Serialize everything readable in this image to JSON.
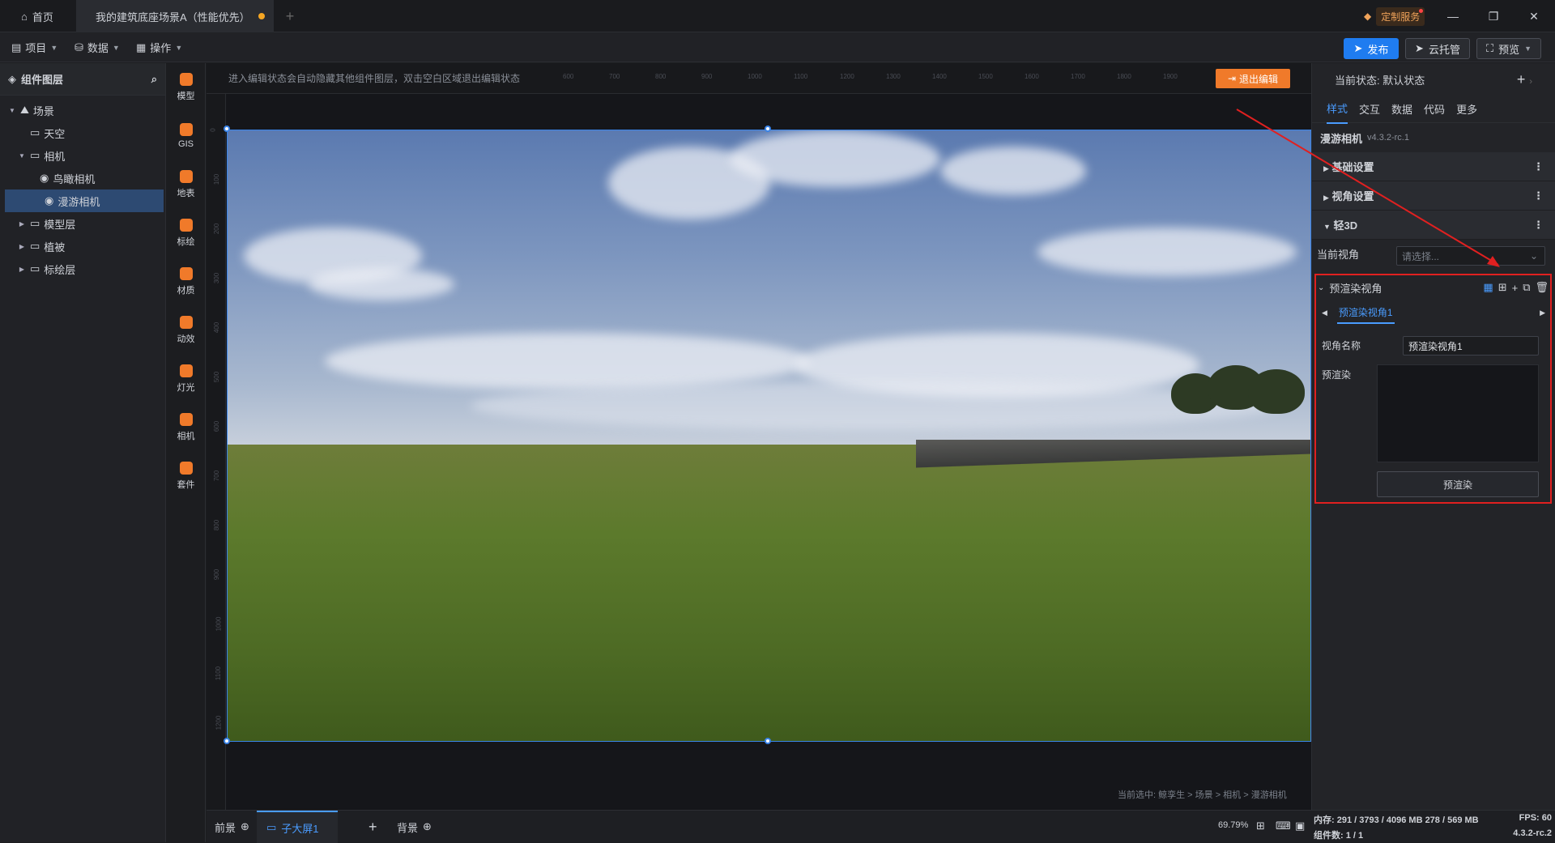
{
  "titlebar": {
    "home_tab": "首页",
    "project_tab": "我的建筑底座场景A（性能优先）",
    "custom_service": "定制服务"
  },
  "menubar": {
    "project": "项目",
    "data": "数据",
    "operate": "操作",
    "publish": "发布",
    "cloud": "云托管",
    "preview": "预览"
  },
  "layers": {
    "title": "组件图层",
    "items": [
      {
        "label": "场景",
        "level": 0,
        "arrow": "▼"
      },
      {
        "label": "天空",
        "level": 1,
        "arrow": ""
      },
      {
        "label": "相机",
        "level": 1,
        "arrow": "▼"
      },
      {
        "label": "鸟瞰相机",
        "level": 2,
        "arrow": ""
      },
      {
        "label": "漫游相机",
        "level": 2,
        "arrow": "",
        "selected": true
      },
      {
        "label": "模型层",
        "level": 1,
        "arrow": "▶"
      },
      {
        "label": "植被",
        "level": 1,
        "arrow": "▶"
      },
      {
        "label": "标绘层",
        "level": 1,
        "arrow": "▶"
      }
    ]
  },
  "icon_column": [
    "模型",
    "GIS",
    "地表",
    "标绘",
    "材质",
    "动效",
    "灯光",
    "相机",
    "套件"
  ],
  "canvas": {
    "hint": "进入编辑状态会自动隐藏其他组件图层，双击空白区域退出编辑状态",
    "exit_edit": "退出编辑",
    "breadcrumb": "当前选中: 鲸孪生 > 场景 > 相机 > 漫游相机"
  },
  "ruler": {
    "top": [
      "600",
      "700",
      "800",
      "900",
      "1000",
      "1100",
      "1200",
      "1300",
      "1400",
      "1500",
      "1600",
      "1700",
      "1800",
      "1900"
    ],
    "left": [
      "0",
      "100",
      "200",
      "300",
      "400",
      "500",
      "600",
      "700",
      "800",
      "900",
      "1000",
      "1100",
      "1200"
    ]
  },
  "bottombar": {
    "front": "前景",
    "screen": "子大屏1",
    "background": "背景",
    "zoom": "69.79%"
  },
  "right_panel": {
    "state_label": "当前状态: 默认状态",
    "tabs": [
      "样式",
      "交互",
      "数据",
      "代码",
      "更多"
    ],
    "component_title": "漫游相机",
    "version": "v4.3.2-rc.1",
    "sections": [
      "基础设置",
      "视角设置",
      "轻3D"
    ],
    "current_view_label": "当前视角",
    "current_view_placeholder": "请选择...",
    "prerender_title": "预渲染视角",
    "prerender_tab": "预渲染视角1",
    "view_name_label": "视角名称",
    "view_name_value": "预渲染视角1",
    "prerender_label": "预渲染",
    "prerender_button": "预渲染"
  },
  "statusbar": {
    "memory": "内存: 291 / 3793 / 4096 MB 278 / 569 MB",
    "components": "组件数: 1 / 1",
    "fps": "FPS: 60",
    "version": "4.3.2-rc.2"
  },
  "colors": {
    "accent": "#1f7cf0",
    "orange": "#f07a2a",
    "highlight": "#e02020"
  }
}
